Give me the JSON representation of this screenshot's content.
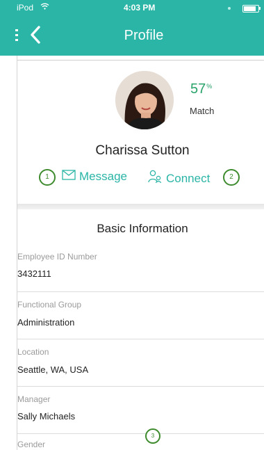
{
  "status_bar": {
    "carrier": "iPod",
    "time": "4:03 PM"
  },
  "nav": {
    "title": "Profile"
  },
  "profile": {
    "name": "Charissa Sutton",
    "match_percent": "57",
    "match_percent_sign": "%",
    "match_label": "Match"
  },
  "actions": {
    "message_label": "Message",
    "connect_label": "Connect"
  },
  "callouts": [
    "1",
    "2",
    "3"
  ],
  "basic_info": {
    "heading": "Basic Information",
    "fields": [
      {
        "label": "Employee ID Number",
        "value": "3432111"
      },
      {
        "label": "Functional Group",
        "value": "Administration"
      },
      {
        "label": "Location",
        "value": "Seattle, WA, USA"
      },
      {
        "label": "Manager",
        "value": "Sally Michaels"
      },
      {
        "label": "Gender",
        "value": ""
      }
    ]
  },
  "colors": {
    "header": "#2ab5a6",
    "accent": "#2ab5a6",
    "match": "#2aa36b",
    "callout": "#3d8b2d"
  },
  "icons": [
    "wifi-icon",
    "battery-icon",
    "menu-icon",
    "back-chevron-icon",
    "message-envelope-icon",
    "connect-people-icon"
  ]
}
